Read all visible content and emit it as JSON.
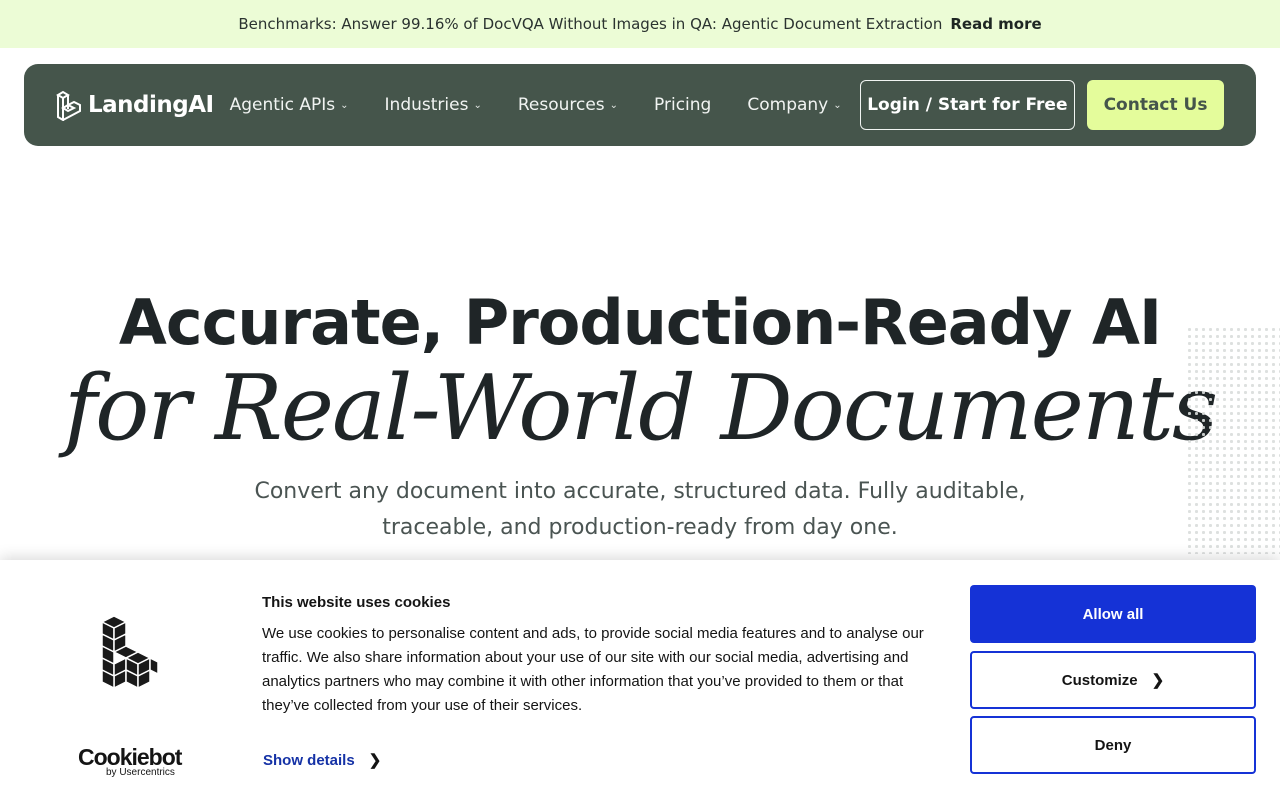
{
  "announcement": {
    "text": "Benchmarks: Answer 99.16% of DocVQA Without Images in QA: Agentic Document Extraction",
    "link": "Read more"
  },
  "nav": {
    "logo": "LandingAI",
    "items": [
      {
        "label": "Agentic APIs",
        "dropdown": true
      },
      {
        "label": "Industries",
        "dropdown": true
      },
      {
        "label": "Resources",
        "dropdown": true
      },
      {
        "label": "Pricing",
        "dropdown": false
      },
      {
        "label": "Company",
        "dropdown": true
      }
    ],
    "login": "Login / Start for Free",
    "contact": "Contact Us"
  },
  "hero": {
    "title_line1": "Accurate, Production-Ready AI",
    "title_line2": "for Real-World Documents",
    "subtitle": "Convert any document into accurate, structured data. Fully auditable, traceable, and production-ready from day one."
  },
  "cookie": {
    "title": "This website uses cookies",
    "body": "We use cookies to personalise content and ads, to provide social media features and to analyse our traffic. We also share information about your use of our site with our social media, advertising and analytics partners who may combine it with other information that you’ve provided to them or that they’ve collected from your use of their services.",
    "show_details": "Show details",
    "brand": "Cookiebot",
    "brand_by": "by Usercentrics",
    "allow_all": "Allow all",
    "customize": "Customize",
    "deny": "Deny"
  },
  "colors": {
    "announce_bg": "#ecfcd6",
    "nav_bg": "#45554b",
    "contact_bg": "#e4fc9b",
    "cookie_accent": "#1532d6"
  }
}
